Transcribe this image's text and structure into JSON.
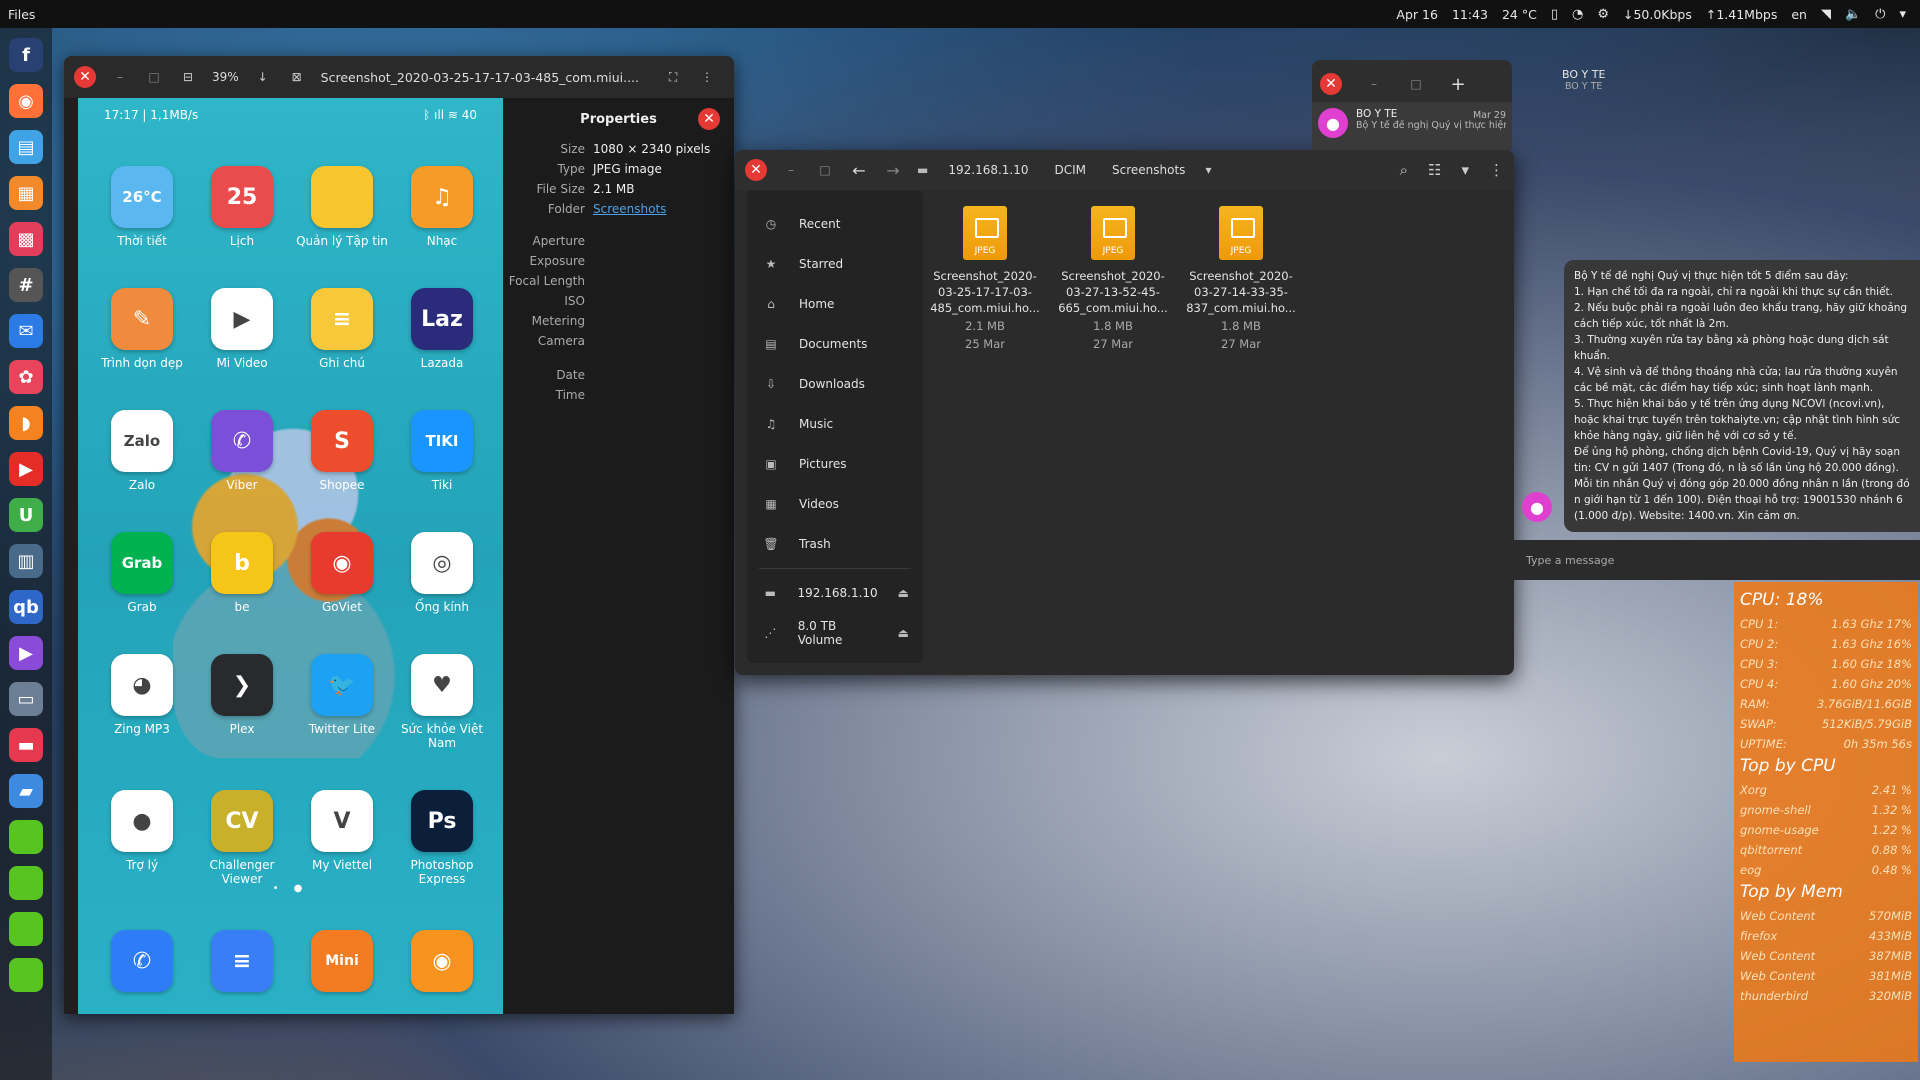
{
  "topbar": {
    "app": "Files",
    "date": "Apr 16",
    "time": "11:43",
    "temp": "24 °C",
    "down": "↓50.0Kbps",
    "up": "↑1.41Mbps",
    "lang": "en"
  },
  "dock": {
    "icons": [
      "fedora-icon",
      "firefox-icon",
      "calculator-icon",
      "store-icon",
      "puzzle-icon",
      "terminal-icon",
      "thunderbird-icon",
      "chrome-icon",
      "rss-icon",
      "youtube-icon",
      "green-app-icon",
      "monitor-icon",
      "qbittorrent-icon",
      "video-icon",
      "files-icon",
      "red-app-icon",
      "folder-icon",
      "green-square-icon",
      "green-square-icon",
      "green-square-icon",
      "green-square-icon"
    ]
  },
  "viewer": {
    "zoom": "39%",
    "title": "Screenshot_2020-03-25-17-17-03-485_com.miui....",
    "phone_status_left": "17:17 | 1,1MB/s",
    "phone_status_right": "ᛒ ıll ≋ 40",
    "apps": [
      {
        "label": "Thời tiết",
        "glyph": "26°C",
        "color": "#5ab7f0",
        "icon": "weather-icon"
      },
      {
        "label": "Lịch",
        "glyph": "25",
        "color": "#e84c4c",
        "icon": "calendar-icon"
      },
      {
        "label": "Quản lý Tập tin",
        "glyph": "",
        "color": "#f7c62f",
        "icon": "file-manager-icon"
      },
      {
        "label": "Nhạc",
        "glyph": "♫",
        "color": "#f69b27",
        "icon": "music-icon"
      },
      {
        "label": "Trình dọn dẹp",
        "glyph": "✎",
        "color": "#f08a3c",
        "icon": "cleaner-icon"
      },
      {
        "label": "Mi Video",
        "glyph": "▶",
        "color": "#ffffff",
        "icon": "mi-video-icon"
      },
      {
        "label": "Ghi chú",
        "glyph": "≡",
        "color": "#f7c93a",
        "icon": "notes-icon"
      },
      {
        "label": "Lazada",
        "glyph": "Laz",
        "color": "#2a2b7a",
        "icon": "lazada-icon"
      },
      {
        "label": "Zalo",
        "glyph": "Zalo",
        "color": "#ffffff",
        "icon": "zalo-icon"
      },
      {
        "label": "Viber",
        "glyph": "✆",
        "color": "#7b4fd8",
        "icon": "viber-icon"
      },
      {
        "label": "Shopee",
        "glyph": "S",
        "color": "#ee4d2d",
        "icon": "shopee-icon"
      },
      {
        "label": "Tiki",
        "glyph": "TIKI",
        "color": "#1a94ff",
        "icon": "tiki-icon"
      },
      {
        "label": "Grab",
        "glyph": "Grab",
        "color": "#00b14f",
        "icon": "grab-icon"
      },
      {
        "label": "be",
        "glyph": "b",
        "color": "#f5c518",
        "icon": "be-icon"
      },
      {
        "label": "GoViet",
        "glyph": "◉",
        "color": "#e63b2e",
        "icon": "goviet-icon"
      },
      {
        "label": "Ống kính",
        "glyph": "◎",
        "color": "#ffffff",
        "icon": "lens-icon"
      },
      {
        "label": "Zing MP3",
        "glyph": "◕",
        "color": "#ffffff",
        "icon": "zing-mp3-icon"
      },
      {
        "label": "Plex",
        "glyph": "❯",
        "color": "#282a2d",
        "icon": "plex-icon"
      },
      {
        "label": "Twitter Lite",
        "glyph": "🐦",
        "color": "#1da1f2",
        "icon": "twitter-icon"
      },
      {
        "label": "Sức khỏe Việt Nam",
        "glyph": "♥",
        "color": "#ffffff",
        "icon": "health-icon"
      },
      {
        "label": "Trợ lý",
        "glyph": "●",
        "color": "#ffffff",
        "icon": "assistant-icon"
      },
      {
        "label": "Challenger Viewer",
        "glyph": "CV",
        "color": "#c9b02b",
        "icon": "challenger-icon"
      },
      {
        "label": "My Viettel",
        "glyph": "V",
        "color": "#ffffff",
        "icon": "viettel-icon"
      },
      {
        "label": "Photoshop Express",
        "glyph": "Ps",
        "color": "#0b1f3a",
        "icon": "photoshop-icon"
      }
    ],
    "bottom_apps": [
      {
        "glyph": "✆",
        "color": "#2e7cf6",
        "icon": "phone-icon"
      },
      {
        "glyph": "≡",
        "color": "#3a7ef5",
        "icon": "messages-icon"
      },
      {
        "glyph": "Mini",
        "color": "#f37b21",
        "icon": "uc-mini-icon"
      },
      {
        "glyph": "◉",
        "color": "#f7931e",
        "icon": "camera-icon"
      }
    ]
  },
  "properties": {
    "title": "Properties",
    "rows": [
      {
        "k": "Size",
        "v": "1080 × 2340 pixels"
      },
      {
        "k": "Type",
        "v": "JPEG image"
      },
      {
        "k": "File Size",
        "v": "2.1 MB"
      },
      {
        "k": "Folder",
        "v": "Screenshots",
        "link": true
      }
    ],
    "rows2": [
      {
        "k": "Aperture",
        "v": ""
      },
      {
        "k": "Exposure",
        "v": ""
      },
      {
        "k": "Focal Length",
        "v": ""
      },
      {
        "k": "ISO",
        "v": ""
      },
      {
        "k": "Metering",
        "v": ""
      },
      {
        "k": "Camera",
        "v": ""
      }
    ],
    "rows3": [
      {
        "k": "Date",
        "v": ""
      },
      {
        "k": "Time",
        "v": ""
      }
    ]
  },
  "files": {
    "breadcrumbs": [
      "192.168.1.10",
      "DCIM",
      "Screenshots"
    ],
    "sidebar": [
      {
        "label": "Recent",
        "icon": "clock-icon",
        "glyph": "◷"
      },
      {
        "label": "Starred",
        "icon": "star-icon",
        "glyph": "★"
      },
      {
        "label": "Home",
        "icon": "home-icon",
        "glyph": "⌂"
      },
      {
        "label": "Documents",
        "icon": "document-icon",
        "glyph": "▤"
      },
      {
        "label": "Downloads",
        "icon": "download-icon",
        "glyph": "⇩"
      },
      {
        "label": "Music",
        "icon": "music-note-icon",
        "glyph": "♫"
      },
      {
        "label": "Pictures",
        "icon": "picture-icon",
        "glyph": "▣"
      },
      {
        "label": "Videos",
        "icon": "video-icon",
        "glyph": "▦"
      },
      {
        "label": "Trash",
        "icon": "trash-icon",
        "glyph": "🗑"
      }
    ],
    "mounts": [
      {
        "label": "192.168.1.10",
        "icon": "network-folder-icon",
        "glyph": "▬"
      },
      {
        "label": "8.0 TB Volume",
        "icon": "drive-icon",
        "glyph": "⋰"
      }
    ],
    "items": [
      {
        "name": "Screenshot_2020-03-25-17-17-03-485_com.miui.ho...",
        "size": "2.1 MB",
        "date": "25 Mar",
        "line1": "Screenshot_2020-",
        "line2": "03-25-17-17-03-",
        "line3": "485_com.miui.ho..."
      },
      {
        "name": "Screenshot_2020-03-27-13-52-45-665_com.miui.ho...",
        "size": "1.8 MB",
        "date": "27 Mar",
        "line1": "Screenshot_2020-",
        "line2": "03-27-13-52-45-",
        "line3": "665_com.miui.ho..."
      },
      {
        "name": "Screenshot_2020-03-27-14-33-35-837_com.miui.ho...",
        "size": "1.8 MB",
        "date": "27 Mar",
        "line1": "Screenshot_2020-",
        "line2": "03-27-14-33-35-",
        "line3": "837_com.miui.ho..."
      }
    ],
    "file_type_label": "JPEG"
  },
  "chat": {
    "header_name": "BO Y TE",
    "header_sub": "BO Y TE",
    "conversation": {
      "name": "BO Y TE",
      "date": "Mar 29",
      "preview": "Bộ Y tế đề nghị Quý vị thực hiện t..."
    },
    "message_lines": [
      "Bộ Y tế đề nghị Quý vị thực hiện tốt 5 điểm sau đây:",
      "1. Hạn chế tối đa ra ngoài, chỉ ra ngoài khi thực sự cần thiết.",
      "2. Nếu buộc phải ra ngoài luôn đeo khẩu trang, hãy giữ khoảng cách tiếp xúc, tốt nhất là 2m.",
      "3. Thường xuyên rửa tay bằng xà phòng hoặc dung dịch sát khuẩn.",
      "4. Vệ sinh và để thông thoáng nhà cửa; lau rửa thường xuyên các bề mặt, các điểm hay tiếp xúc; sinh hoạt lành mạnh.",
      "5. Thực hiện khai báo y tế trên ứng dụng NCOVI (ncovi.vn), hoặc khai trực tuyến trên tokhaiyte.vn; cập nhật tình hình sức khỏe hàng ngày, giữ liên hệ với cơ sở y tế.",
      "Để ủng hộ phòng, chống dịch bệnh Covid-19, Quý vị hãy soạn tin: CV n gửi 1407 (Trong đó, n là số lần ủng hộ 20.000 đồng). Mỗi tin nhắn Quý vị đóng góp 20.000 đồng nhân n lần (trong đó n giới hạn từ 1 đến 100). Điện thoại hỗ trợ: 19001530 nhánh 6 (1.000 đ/p). Website: 1400.vn. Xin cảm ơn."
    ],
    "input_placeholder": "Type a message"
  },
  "conky": {
    "cpu_total": "CPU: 18%",
    "cpus": [
      {
        "k": "CPU 1:",
        "v": "1.63 Ghz 17%"
      },
      {
        "k": "CPU 2:",
        "v": "1.63 Ghz 16%"
      },
      {
        "k": "CPU 3:",
        "v": "1.60 Ghz 18%"
      },
      {
        "k": "CPU 4:",
        "v": "1.60 Ghz 20%"
      },
      {
        "k": "RAM:",
        "v": "3.76GiB/11.6GiB"
      },
      {
        "k": "SWAP:",
        "v": "512KiB/5.79GiB"
      },
      {
        "k": "UPTIME:",
        "v": "0h 35m 56s"
      }
    ],
    "top_cpu_title": "Top by CPU",
    "top_cpu": [
      {
        "k": "Xorg",
        "v": "2.41 %"
      },
      {
        "k": "gnome-shell",
        "v": "1.32 %"
      },
      {
        "k": "gnome-usage",
        "v": "1.22 %"
      },
      {
        "k": "qbittorrent",
        "v": "0.88 %"
      },
      {
        "k": "eog",
        "v": "0.48 %"
      }
    ],
    "top_mem_title": "Top by Mem",
    "top_mem": [
      {
        "k": "Web Content",
        "v": "570MiB"
      },
      {
        "k": "firefox",
        "v": "433MiB"
      },
      {
        "k": "Web Content",
        "v": "387MiB"
      },
      {
        "k": "Web Content",
        "v": "381MiB"
      },
      {
        "k": "thunderbird",
        "v": "320MiB"
      }
    ]
  }
}
